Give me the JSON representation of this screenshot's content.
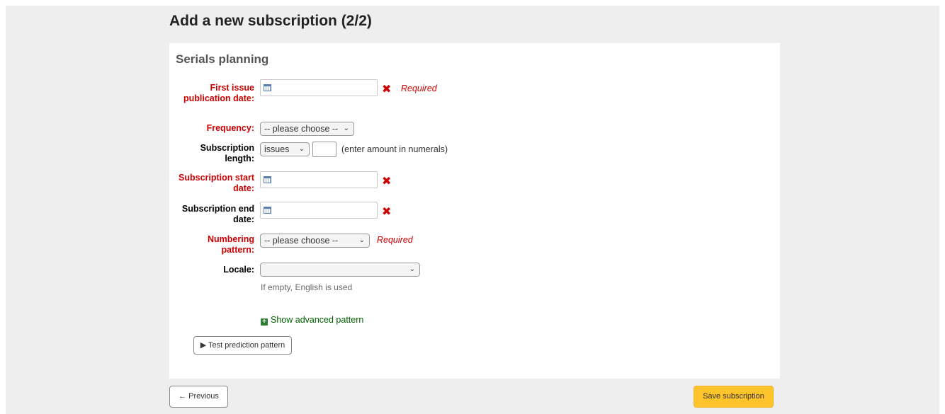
{
  "page": {
    "title": "Add a new subscription (2/2)"
  },
  "section": {
    "title": "Serials planning"
  },
  "fields": {
    "first_issue": {
      "label": "First issue publication date:",
      "required_text": "Required"
    },
    "frequency": {
      "label": "Frequency:",
      "value": "-- please choose --"
    },
    "subscription_length": {
      "label": "Subscription length:",
      "unit": "issues",
      "value": "",
      "hint": "(enter amount in numerals)"
    },
    "start_date": {
      "label": "Subscription start date:"
    },
    "end_date": {
      "label": "Subscription end date:"
    },
    "numbering_pattern": {
      "label": "Numbering pattern:",
      "value": "-- please choose --",
      "required_text": "Required"
    },
    "locale": {
      "label": "Locale:",
      "value": "",
      "help": "If empty, English is used"
    }
  },
  "links": {
    "show_advanced": "Show advanced pattern"
  },
  "buttons": {
    "test_prediction": "▶ Test prediction pattern",
    "previous": "← Previous",
    "save": "Save subscription"
  },
  "icons": {
    "calendar": "calendar-icon",
    "clear": "close-icon",
    "chevron": "chevron-down-icon",
    "plus": "plus-square-icon"
  },
  "colors": {
    "required": "#cc0000",
    "save_button": "#ffc32b",
    "link": "#006100"
  }
}
